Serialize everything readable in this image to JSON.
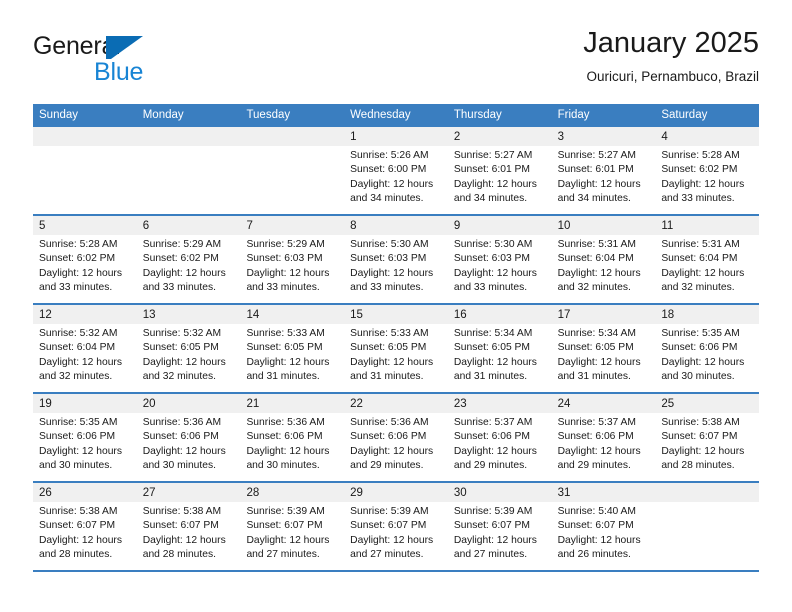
{
  "brand": {
    "line1": "General",
    "line2": "Blue",
    "flag_icon": "triangle-flag-icon",
    "accent_color": "#0a6cb4",
    "blue_text_color": "#1884d4"
  },
  "header": {
    "title": "January 2025",
    "subtitle": "Ouricuri, Pernambuco, Brazil"
  },
  "calendar": {
    "header_bg": "#3a7ec0",
    "day_number_bg": "#f0f0f0",
    "weekdays": [
      "Sunday",
      "Monday",
      "Tuesday",
      "Wednesday",
      "Thursday",
      "Friday",
      "Saturday"
    ],
    "weeks": [
      [
        {
          "day": "",
          "empty": true
        },
        {
          "day": "",
          "empty": true
        },
        {
          "day": "",
          "empty": true
        },
        {
          "day": "1",
          "sunrise": "Sunrise: 5:26 AM",
          "sunset": "Sunset: 6:00 PM",
          "daylight": "Daylight: 12 hours and 34 minutes."
        },
        {
          "day": "2",
          "sunrise": "Sunrise: 5:27 AM",
          "sunset": "Sunset: 6:01 PM",
          "daylight": "Daylight: 12 hours and 34 minutes."
        },
        {
          "day": "3",
          "sunrise": "Sunrise: 5:27 AM",
          "sunset": "Sunset: 6:01 PM",
          "daylight": "Daylight: 12 hours and 34 minutes."
        },
        {
          "day": "4",
          "sunrise": "Sunrise: 5:28 AM",
          "sunset": "Sunset: 6:02 PM",
          "daylight": "Daylight: 12 hours and 33 minutes."
        }
      ],
      [
        {
          "day": "5",
          "sunrise": "Sunrise: 5:28 AM",
          "sunset": "Sunset: 6:02 PM",
          "daylight": "Daylight: 12 hours and 33 minutes."
        },
        {
          "day": "6",
          "sunrise": "Sunrise: 5:29 AM",
          "sunset": "Sunset: 6:02 PM",
          "daylight": "Daylight: 12 hours and 33 minutes."
        },
        {
          "day": "7",
          "sunrise": "Sunrise: 5:29 AM",
          "sunset": "Sunset: 6:03 PM",
          "daylight": "Daylight: 12 hours and 33 minutes."
        },
        {
          "day": "8",
          "sunrise": "Sunrise: 5:30 AM",
          "sunset": "Sunset: 6:03 PM",
          "daylight": "Daylight: 12 hours and 33 minutes."
        },
        {
          "day": "9",
          "sunrise": "Sunrise: 5:30 AM",
          "sunset": "Sunset: 6:03 PM",
          "daylight": "Daylight: 12 hours and 33 minutes."
        },
        {
          "day": "10",
          "sunrise": "Sunrise: 5:31 AM",
          "sunset": "Sunset: 6:04 PM",
          "daylight": "Daylight: 12 hours and 32 minutes."
        },
        {
          "day": "11",
          "sunrise": "Sunrise: 5:31 AM",
          "sunset": "Sunset: 6:04 PM",
          "daylight": "Daylight: 12 hours and 32 minutes."
        }
      ],
      [
        {
          "day": "12",
          "sunrise": "Sunrise: 5:32 AM",
          "sunset": "Sunset: 6:04 PM",
          "daylight": "Daylight: 12 hours and 32 minutes."
        },
        {
          "day": "13",
          "sunrise": "Sunrise: 5:32 AM",
          "sunset": "Sunset: 6:05 PM",
          "daylight": "Daylight: 12 hours and 32 minutes."
        },
        {
          "day": "14",
          "sunrise": "Sunrise: 5:33 AM",
          "sunset": "Sunset: 6:05 PM",
          "daylight": "Daylight: 12 hours and 31 minutes."
        },
        {
          "day": "15",
          "sunrise": "Sunrise: 5:33 AM",
          "sunset": "Sunset: 6:05 PM",
          "daylight": "Daylight: 12 hours and 31 minutes."
        },
        {
          "day": "16",
          "sunrise": "Sunrise: 5:34 AM",
          "sunset": "Sunset: 6:05 PM",
          "daylight": "Daylight: 12 hours and 31 minutes."
        },
        {
          "day": "17",
          "sunrise": "Sunrise: 5:34 AM",
          "sunset": "Sunset: 6:05 PM",
          "daylight": "Daylight: 12 hours and 31 minutes."
        },
        {
          "day": "18",
          "sunrise": "Sunrise: 5:35 AM",
          "sunset": "Sunset: 6:06 PM",
          "daylight": "Daylight: 12 hours and 30 minutes."
        }
      ],
      [
        {
          "day": "19",
          "sunrise": "Sunrise: 5:35 AM",
          "sunset": "Sunset: 6:06 PM",
          "daylight": "Daylight: 12 hours and 30 minutes."
        },
        {
          "day": "20",
          "sunrise": "Sunrise: 5:36 AM",
          "sunset": "Sunset: 6:06 PM",
          "daylight": "Daylight: 12 hours and 30 minutes."
        },
        {
          "day": "21",
          "sunrise": "Sunrise: 5:36 AM",
          "sunset": "Sunset: 6:06 PM",
          "daylight": "Daylight: 12 hours and 30 minutes."
        },
        {
          "day": "22",
          "sunrise": "Sunrise: 5:36 AM",
          "sunset": "Sunset: 6:06 PM",
          "daylight": "Daylight: 12 hours and 29 minutes."
        },
        {
          "day": "23",
          "sunrise": "Sunrise: 5:37 AM",
          "sunset": "Sunset: 6:06 PM",
          "daylight": "Daylight: 12 hours and 29 minutes."
        },
        {
          "day": "24",
          "sunrise": "Sunrise: 5:37 AM",
          "sunset": "Sunset: 6:06 PM",
          "daylight": "Daylight: 12 hours and 29 minutes."
        },
        {
          "day": "25",
          "sunrise": "Sunrise: 5:38 AM",
          "sunset": "Sunset: 6:07 PM",
          "daylight": "Daylight: 12 hours and 28 minutes."
        }
      ],
      [
        {
          "day": "26",
          "sunrise": "Sunrise: 5:38 AM",
          "sunset": "Sunset: 6:07 PM",
          "daylight": "Daylight: 12 hours and 28 minutes."
        },
        {
          "day": "27",
          "sunrise": "Sunrise: 5:38 AM",
          "sunset": "Sunset: 6:07 PM",
          "daylight": "Daylight: 12 hours and 28 minutes."
        },
        {
          "day": "28",
          "sunrise": "Sunrise: 5:39 AM",
          "sunset": "Sunset: 6:07 PM",
          "daylight": "Daylight: 12 hours and 27 minutes."
        },
        {
          "day": "29",
          "sunrise": "Sunrise: 5:39 AM",
          "sunset": "Sunset: 6:07 PM",
          "daylight": "Daylight: 12 hours and 27 minutes."
        },
        {
          "day": "30",
          "sunrise": "Sunrise: 5:39 AM",
          "sunset": "Sunset: 6:07 PM",
          "daylight": "Daylight: 12 hours and 27 minutes."
        },
        {
          "day": "31",
          "sunrise": "Sunrise: 5:40 AM",
          "sunset": "Sunset: 6:07 PM",
          "daylight": "Daylight: 12 hours and 26 minutes."
        },
        {
          "day": "",
          "empty": true
        }
      ]
    ]
  }
}
